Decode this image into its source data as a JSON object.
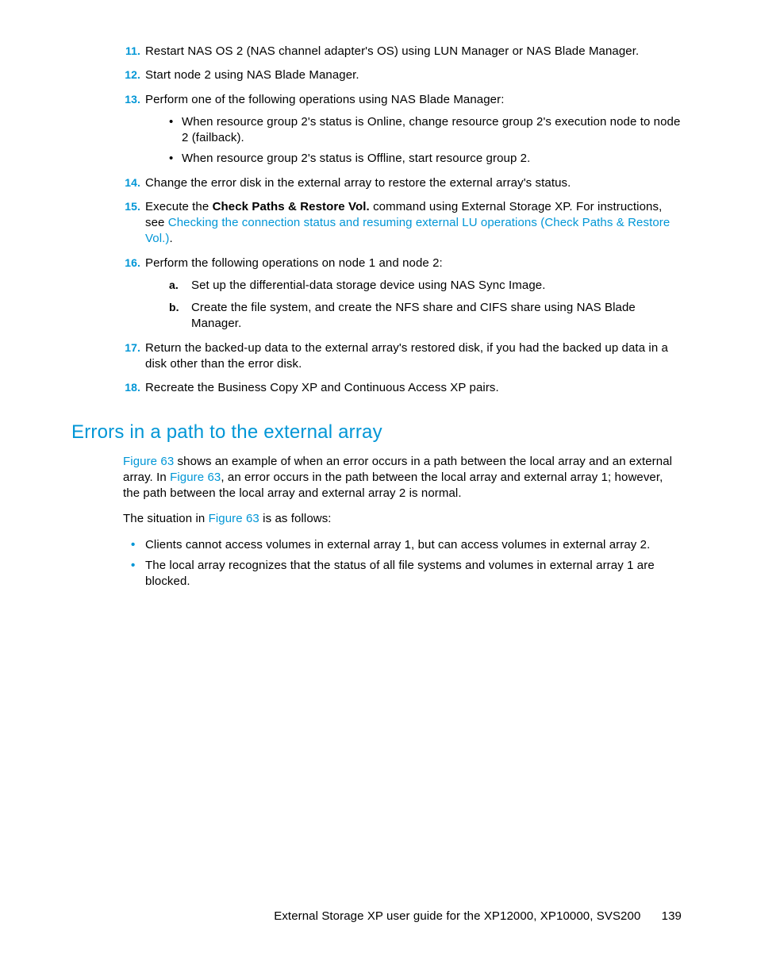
{
  "steps": {
    "s11": {
      "num": "11.",
      "text": "Restart NAS OS 2 (NAS channel adapter's OS) using LUN Manager or NAS Blade Manager."
    },
    "s12": {
      "num": "12.",
      "text": "Start node 2 using NAS Blade Manager."
    },
    "s13": {
      "num": "13.",
      "text": "Perform one of the following operations using NAS Blade Manager:",
      "b1": "When resource group 2's status is Online, change resource group 2's execution node to node 2 (failback).",
      "b2": "When resource group 2's status is Offline, start resource group 2."
    },
    "s14": {
      "num": "14.",
      "text": "Change the error disk in the external array to restore the external array's status."
    },
    "s15": {
      "num": "15.",
      "pre": "Execute the ",
      "bold": "Check Paths & Restore Vol.",
      "post": " command using External Storage XP. For instructions, see ",
      "link": "Checking the connection status and resuming external LU operations (Check Paths & Restore Vol.)",
      "after": "."
    },
    "s16": {
      "num": "16.",
      "text": "Perform the following operations on node 1 and node 2:",
      "a_lbl": "a.",
      "a": "Set up the differential-data storage device using NAS Sync Image.",
      "b_lbl": "b.",
      "b": "Create the file system, and create the NFS share and CIFS share using NAS Blade Manager."
    },
    "s17": {
      "num": "17.",
      "text": "Return the backed-up data to the external array's restored disk, if you had the backed up data in a disk other than the error disk."
    },
    "s18": {
      "num": "18.",
      "text": "Recreate the Business Copy XP and Continuous Access XP pairs."
    }
  },
  "heading": "Errors in a path to the external array",
  "para1": {
    "link1": "Figure 63",
    "t1": " shows an example of when an error occurs in a path between the local array and an external array. In ",
    "link2": "Figure 63",
    "t2": ", an error occurs in the path between the local array and external array 1; however, the path between the local array and external array 2 is normal."
  },
  "para2": {
    "t1": "The situation in ",
    "link": "Figure 63",
    "t2": " is as follows:"
  },
  "bodybullets": {
    "b1": "Clients cannot access volumes in external array 1, but can access volumes in external array 2.",
    "b2": "The local array recognizes that the status of all file systems and volumes in external array 1 are blocked."
  },
  "footer": {
    "title": "External Storage XP user guide for the XP12000, XP10000, SVS200",
    "page": "139"
  }
}
